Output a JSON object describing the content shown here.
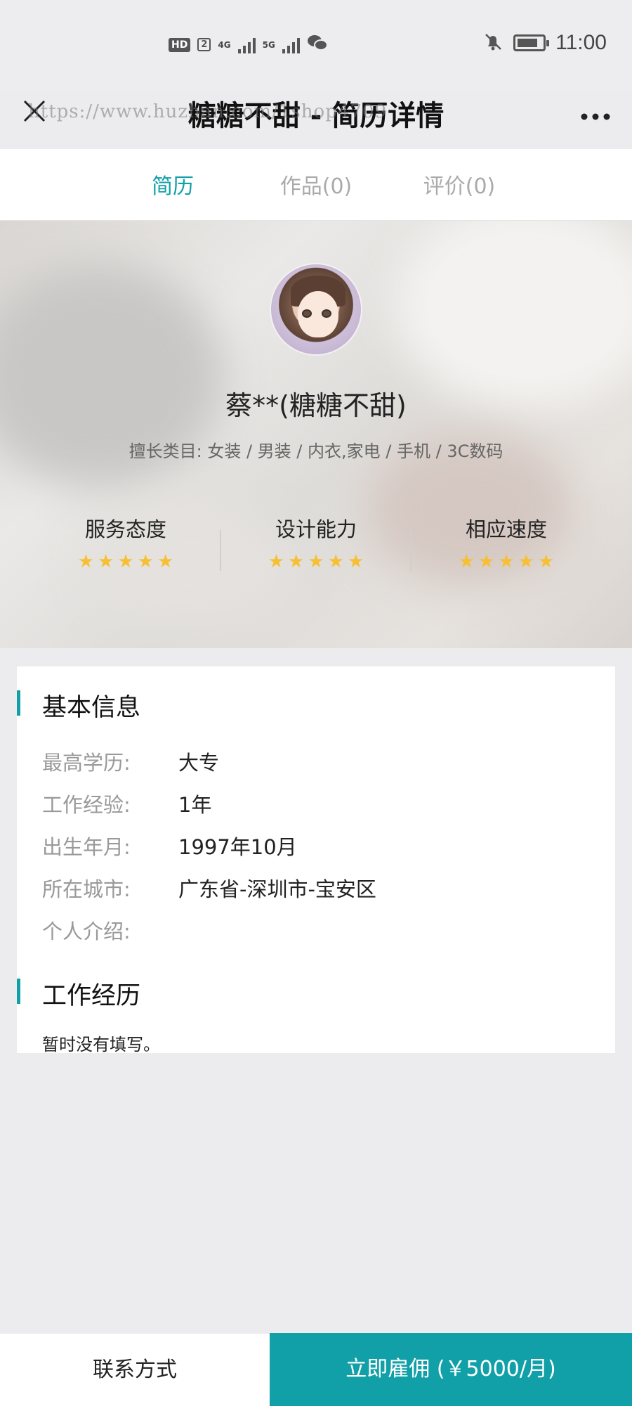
{
  "status_bar": {
    "time": "11:00",
    "hd_label": "HD",
    "sim_label": "2",
    "net_1": "4G",
    "net_2": "5G",
    "icons": [
      "signal-icon",
      "wechat-icon",
      "mute-bell-icon",
      "battery-charging-icon"
    ]
  },
  "header": {
    "title": "糖糖不甜 - 简历详情",
    "watermark": "https://www.huzhan.com/1shop4709"
  },
  "tabs": [
    {
      "label": "简历",
      "active": true
    },
    {
      "label": "作品(0)",
      "active": false
    },
    {
      "label": "评价(0)",
      "active": false
    }
  ],
  "profile": {
    "name": "蔡**(糖糖不甜)",
    "specialties": "擅长类目:  女装 / 男装 / 内衣,家电 / 手机 / 3C数码"
  },
  "ratings": [
    {
      "label": "服务态度",
      "stars": 5
    },
    {
      "label": "设计能力",
      "stars": 5
    },
    {
      "label": "相应速度",
      "stars": 5
    }
  ],
  "basic_info": {
    "title": "基本信息",
    "rows": [
      {
        "label": "最高学历:",
        "value": "大专"
      },
      {
        "label": "工作经验:",
        "value": "1年"
      },
      {
        "label": "出生年月:",
        "value": "1997年10月"
      },
      {
        "label": "所在城市:",
        "value": "广东省-深圳市-宝安区"
      },
      {
        "label": "个人介绍:",
        "value": ""
      }
    ]
  },
  "work_experience": {
    "title": "工作经历",
    "text": "暂时没有填写。"
  },
  "bottom_bar": {
    "contact_label": "联系方式",
    "hire_label": "立即雇佣 (￥5000/月)"
  },
  "colors": {
    "accent": "#12a0a8",
    "star": "#f6c032"
  }
}
